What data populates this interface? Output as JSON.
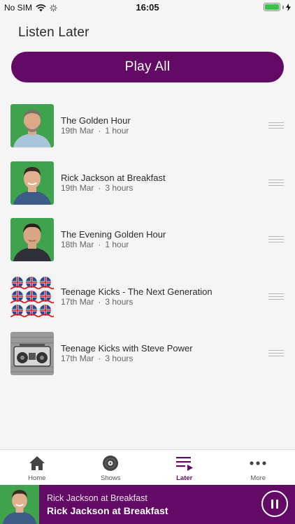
{
  "status_bar": {
    "carrier": "No SIM",
    "time": "16:05"
  },
  "page": {
    "title": "Listen Later",
    "play_all_label": "Play All"
  },
  "items": [
    {
      "title": "The Golden Hour",
      "date": "19th Mar",
      "duration": "1 hour",
      "thumb": "presenter-grey-beard"
    },
    {
      "title": "Rick Jackson at Breakfast",
      "date": "19th Mar",
      "duration": "3 hours",
      "thumb": "presenter-rick"
    },
    {
      "title": "The Evening Golden Hour",
      "date": "18th Mar",
      "duration": "1 hour",
      "thumb": "presenter-dark-hair"
    },
    {
      "title": "Teenage Kicks - The Next Generation",
      "date": "17th Mar",
      "duration": "3 hours",
      "thumb": "union-jack-pattern"
    },
    {
      "title": "Teenage Kicks with Steve Power",
      "date": "17th Mar",
      "duration": "3 hours",
      "thumb": "boombox"
    }
  ],
  "tabs": [
    {
      "label": "Home",
      "icon": "home-icon",
      "active": false
    },
    {
      "label": "Shows",
      "icon": "disc-icon",
      "active": false
    },
    {
      "label": "Later",
      "icon": "playlist-icon",
      "active": true
    },
    {
      "label": "More",
      "icon": "more-icon",
      "active": false
    }
  ],
  "mini_player": {
    "subtitle": "Rick Jackson at Breakfast",
    "title": "Rick Jackson at Breakfast",
    "state": "playing"
  },
  "colors": {
    "brand": "#620a66",
    "background": "#f5f5f5",
    "thumb_green": "#3fa34d",
    "battery": "#3ac24a"
  }
}
